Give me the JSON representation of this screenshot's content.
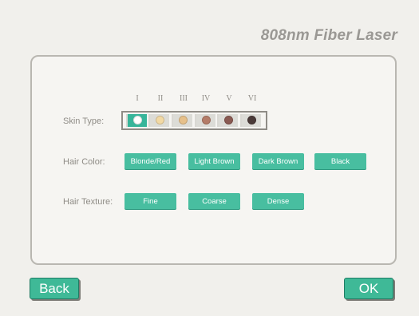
{
  "header": {
    "title": "808nm Fiber Laser"
  },
  "skin_type": {
    "label": "Skin Type:",
    "numerals": [
      "I",
      "II",
      "III",
      "IV",
      "V",
      "VI"
    ],
    "colors": [
      "#ffffff",
      "#f2d9a4",
      "#e6c08a",
      "#b47c68",
      "#8a5a52",
      "#4a3a38"
    ],
    "segment_color_selected": "#37b59a",
    "segment_color_alt": "#dcdcd7"
  },
  "hair_color": {
    "label": "Hair Color:",
    "options": [
      "Blonde/Red",
      "Light Brown",
      "Dark Brown",
      "Black"
    ]
  },
  "hair_texture": {
    "label": "Hair Texture:",
    "options": [
      "Fine",
      "Coarse",
      "Dense"
    ]
  },
  "footer": {
    "back_label": "Back",
    "ok_label": "OK"
  },
  "colors": {
    "accent": "#48bea0",
    "background": "#f1f0ec",
    "text_muted": "#8f8c86"
  }
}
